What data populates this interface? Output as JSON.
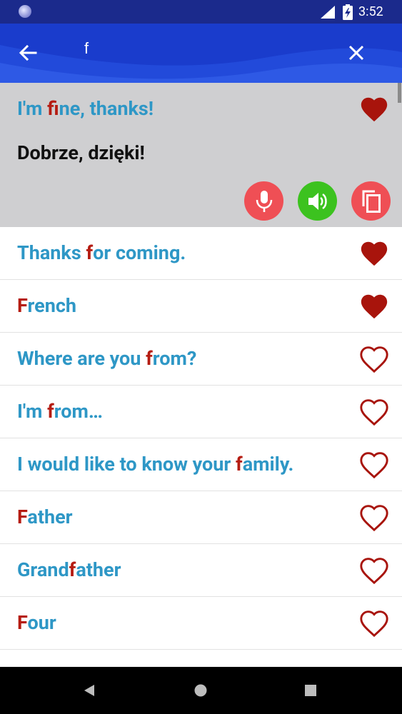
{
  "status_bar": {
    "time": "3:52"
  },
  "search": {
    "query": "f"
  },
  "colors": {
    "accent_blue": "#2e97c6",
    "highlight_red": "#b51c12",
    "header_blue": "#1a3ccc",
    "mic_red": "#ef4f55",
    "speaker_green": "#3cc21f"
  },
  "expanded": {
    "phrase": {
      "before": "I'm ",
      "match": "f",
      "after": "ine, thanks!"
    },
    "translation": "Dobrze, dzięki!",
    "favorite": true
  },
  "items": [
    {
      "before": "Thanks ",
      "match": "f",
      "after": "or coming.",
      "favorite": true
    },
    {
      "before": "",
      "match": "F",
      "after": "rench",
      "favorite": true
    },
    {
      "before": "Where are you ",
      "match": "f",
      "after": "rom?",
      "favorite": false
    },
    {
      "before": "I'm ",
      "match": "f",
      "after": "rom…",
      "favorite": false
    },
    {
      "before": "I would like to know your ",
      "match": "f",
      "after": "amily.",
      "favorite": false
    },
    {
      "before": "",
      "match": "F",
      "after": "ather",
      "favorite": false
    },
    {
      "before": "Grand",
      "match": "f",
      "after": "ather",
      "favorite": false
    },
    {
      "before": "",
      "match": "F",
      "after": "our",
      "favorite": false
    }
  ]
}
